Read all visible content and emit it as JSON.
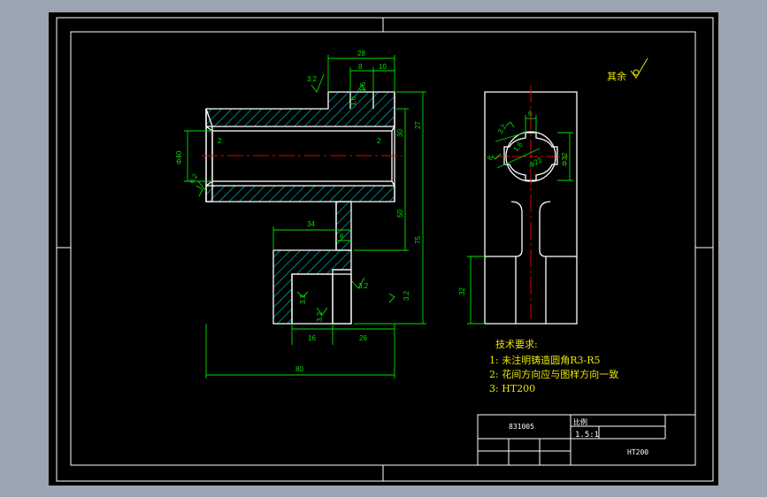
{
  "colors": {
    "desktop": "#9aa4b2",
    "sheet": "#000000",
    "outline": "#ffffff",
    "dimension": "#00e000",
    "centerline": "#e00000",
    "hatch": "#00d0d0",
    "text_yellow": "#e8e800"
  },
  "dimensions": {
    "d_28": "28",
    "d_8": "8",
    "d_10": "10",
    "d_3_2_top": "3.2",
    "d_1_6_a": "1.6",
    "d_1_6_b": "1.6",
    "d_2_left": "2",
    "d_2_right": "2",
    "d_phi40": "Φ40",
    "d_6_2": "6.2",
    "d_30": "30",
    "d_27": "27",
    "d_34": "34",
    "d_6": "6",
    "d_50": "50",
    "d_75": "75",
    "d_3_2_mid": "3.2",
    "d_3_2_lower": "3.2",
    "d_3_2_left": "3.2",
    "d_3_2_right": "3.2",
    "d_16": "16",
    "d_26": "26",
    "d_80": "80",
    "d_6_side": "6",
    "d_phi22": "Φ22",
    "d_phi32": "Φ32",
    "d_3_2_side": "3.2",
    "d_1_6_side": "1.6",
    "d_8_side": "8",
    "d_32": "32"
  },
  "roughness_note": "其余",
  "tech": {
    "heading": "技术要求:",
    "items": [
      "1: 未注明铸造圆角R3-R5",
      "2: 花间方向应与图样方向一致",
      "3: HT200"
    ]
  },
  "title_block": {
    "drawing_no": "831005",
    "scale_label": "比例",
    "scale_value": "1.5:1",
    "material": "HT200"
  }
}
